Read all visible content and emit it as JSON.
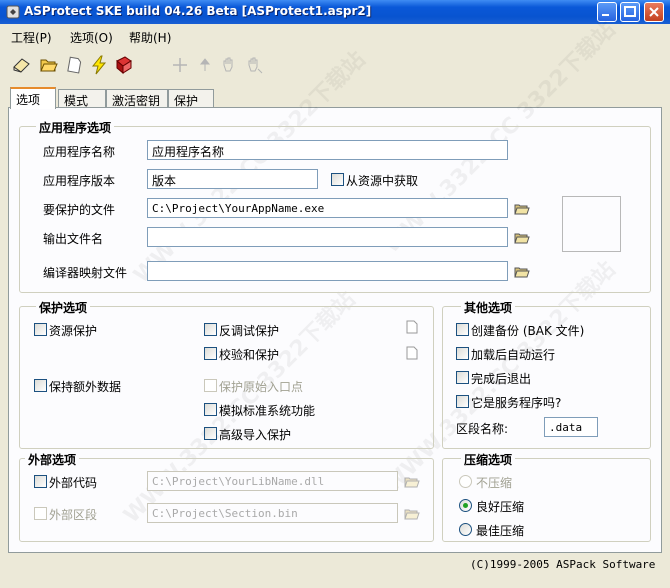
{
  "window": {
    "title": "ASProtect SKE       build 04.26 Beta [ASProtect1.aspr2]"
  },
  "menu": [
    "工程(P)",
    "选项(O)",
    "帮助(H)"
  ],
  "toolbar": {
    "icons": [
      "new-project-icon",
      "open-project-icon",
      "blank-document-icon",
      "protect-lightning-icon",
      "help-book-icon",
      "move-icon",
      "arrow-up-icon",
      "grab-hand-icon",
      "grab-hand-disabled-icon"
    ]
  },
  "tabs": [
    {
      "label": "选项",
      "active": true
    },
    {
      "label": "模式",
      "active": false
    },
    {
      "label": "激活密钥",
      "active": false
    },
    {
      "label": "保护",
      "active": false
    }
  ],
  "app_options": {
    "title": "应用程序选项",
    "name_label": "应用程序名称",
    "name_value": "应用程序名称",
    "version_label": "应用程序版本",
    "version_value": "版本",
    "from_resource_label": "从资源中获取",
    "from_resource_checked": false,
    "file_label": "要保护的文件",
    "file_value": "C:\\Project\\YourAppName.exe",
    "output_label": "输出文件名",
    "output_value": "",
    "map_label": "编译器映射文件",
    "map_value": ""
  },
  "protection": {
    "title": "保护选项",
    "resource_protect": "资源保护",
    "anti_debug": "反调试保护",
    "checksum_protect": "校验和保护",
    "keep_extra_data": "保持额外数据",
    "protect_entry": "保护原始入口点",
    "emulate_api": "模拟标准系统功能",
    "advanced_import": "高级导入保护"
  },
  "other": {
    "title": "其他选项",
    "backup": "创建备份 (BAK 文件)",
    "autorun": "加载后自动运行",
    "exit_after": "完成后退出",
    "is_service": "它是服务程序吗?",
    "section_label": "区段名称:",
    "section_value": ".data"
  },
  "external": {
    "title": "外部选项",
    "code_label": "外部代码",
    "code_value": "C:\\Project\\YourLibName.dll",
    "section_label": "外部区段",
    "section_value": "C:\\Project\\Section.bin"
  },
  "compression": {
    "title": "压缩选项",
    "options": [
      "不压缩",
      "良好压缩",
      "最佳压缩"
    ],
    "selected": "良好压缩"
  },
  "footer": {
    "copyright": "(C)1999-2005  ASPack Software"
  },
  "watermark": "WWW.3322.CC  3322下载站",
  "colors": {
    "titlebar": "#0a58d8",
    "panel_bg": "#ece9d8",
    "tab_accent": "#e68b2c",
    "radio_dot": "#21a121"
  }
}
